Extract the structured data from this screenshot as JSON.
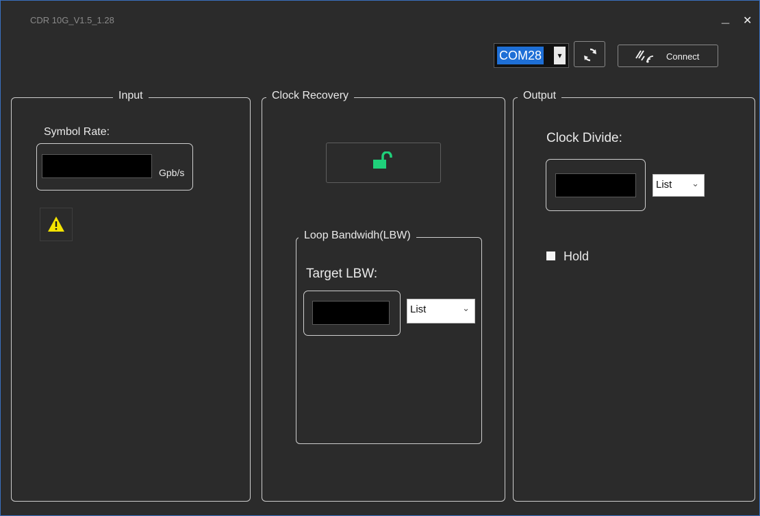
{
  "window": {
    "title": "CDR 10G_V1.5_1.28",
    "minimize_glyph": "_",
    "close_glyph": "✕"
  },
  "toolbar": {
    "port_value": "COM28",
    "port_arrow": "▾",
    "refresh_icon": "refresh-icon",
    "connect_icon": "wireless-signal-icon",
    "connect_label": "Connect"
  },
  "input": {
    "title": "Input",
    "symbol_rate_label": "Symbol Rate:",
    "symbol_rate_value": "",
    "unit": "Gpb/s",
    "warning_icon": "warning-icon"
  },
  "clock_recovery": {
    "title": "Clock Recovery",
    "lock_icon": "unlocked-padlock-icon",
    "loop": {
      "title": "Loop Bandwidh(LBW)",
      "target_label": "Target LBW:",
      "target_value": "",
      "list_value": "List",
      "list_arrow": "⌄"
    }
  },
  "output": {
    "title": "Output",
    "clock_divide_label": "Clock Divide:",
    "clock_divide_value": "",
    "list_value": "List",
    "list_arrow": "⌄",
    "hold_label": "Hold"
  },
  "colors": {
    "background": "#2b2b2b",
    "accent_blue": "#1e6fd6",
    "lock_green": "#1fd07a",
    "warning_yellow": "#f5e400"
  }
}
